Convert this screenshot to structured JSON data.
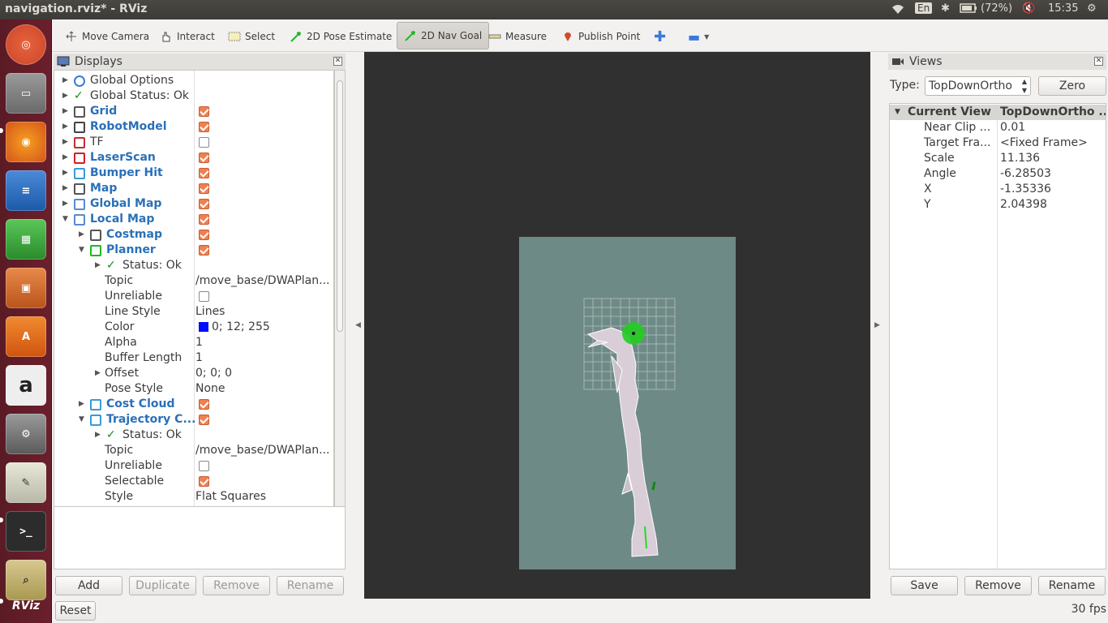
{
  "window": {
    "title": "navigation.rviz* - RViz"
  },
  "indicators": {
    "keyboard": "En",
    "battery": "(72%)",
    "time": "15:35"
  },
  "toolbar": {
    "tools": [
      {
        "label": "Move Camera",
        "icon": "move-camera-icon"
      },
      {
        "label": "Interact",
        "icon": "hand-icon"
      },
      {
        "label": "Select",
        "icon": "select-rect-icon"
      },
      {
        "label": "2D Pose Estimate",
        "icon": "green-arrow-icon"
      },
      {
        "label": "2D Nav Goal",
        "icon": "green-arrow-icon",
        "active": true
      },
      {
        "label": "Measure",
        "icon": "ruler-icon"
      },
      {
        "label": "Publish Point",
        "icon": "map-pin-icon"
      }
    ]
  },
  "displays": {
    "title": "Displays",
    "rows": [
      {
        "label": "Global Options",
        "type": "plain",
        "value": ""
      },
      {
        "label": "Global Status: Ok",
        "type": "plain",
        "value": ""
      },
      {
        "label": "Grid",
        "type": "display",
        "checked": true
      },
      {
        "label": "RobotModel",
        "type": "display",
        "checked": true
      },
      {
        "label": "TF",
        "type": "tf",
        "checked": false
      },
      {
        "label": "LaserScan",
        "type": "display",
        "checked": true
      },
      {
        "label": "Bumper Hit",
        "type": "display",
        "checked": true
      },
      {
        "label": "Map",
        "type": "display",
        "checked": true
      },
      {
        "label": "Global Map",
        "type": "display",
        "checked": true
      },
      {
        "label": "Local Map",
        "type": "display",
        "checked": true
      },
      {
        "label": "Costmap",
        "type": "display",
        "checked": true
      },
      {
        "label": "Planner",
        "type": "display",
        "checked": true
      },
      {
        "label": "Status: Ok",
        "type": "status",
        "value": ""
      },
      {
        "label": "Topic",
        "type": "prop",
        "value": "/move_base/DWAPlan..."
      },
      {
        "label": "Unreliable",
        "type": "prop-cb",
        "checked": false
      },
      {
        "label": "Line Style",
        "type": "prop",
        "value": "Lines"
      },
      {
        "label": "Color",
        "type": "prop-color",
        "value": "0; 12; 255",
        "swatch": "#000cff"
      },
      {
        "label": "Alpha",
        "type": "prop",
        "value": "1"
      },
      {
        "label": "Buffer Length",
        "type": "prop",
        "value": "1"
      },
      {
        "label": "Offset",
        "type": "prop",
        "value": "0; 0; 0"
      },
      {
        "label": "Pose Style",
        "type": "prop",
        "value": "None"
      },
      {
        "label": "Cost Cloud",
        "type": "display",
        "checked": true
      },
      {
        "label": "Trajectory C...",
        "type": "display",
        "checked": true
      },
      {
        "label": "Status: Ok",
        "type": "status",
        "value": ""
      },
      {
        "label": "Topic",
        "type": "prop",
        "value": "/move_base/DWAPlan..."
      },
      {
        "label": "Unreliable",
        "type": "prop-cb",
        "checked": false
      },
      {
        "label": "Selectable",
        "type": "prop-cb",
        "checked": true
      },
      {
        "label": "Style",
        "type": "prop",
        "value": "Flat Squares"
      }
    ],
    "buttons": {
      "add": "Add",
      "duplicate": "Duplicate",
      "remove": "Remove",
      "rename": "Rename"
    }
  },
  "views": {
    "title": "Views",
    "type_label": "Type:",
    "type_value": "TopDownOrtho",
    "zero_label": "Zero",
    "header": {
      "name": "Current View",
      "value": "TopDownOrtho ..."
    },
    "props": [
      {
        "label": "Near Clip ...",
        "value": "0.01"
      },
      {
        "label": "Target Fra...",
        "value": "<Fixed Frame>"
      },
      {
        "label": "Scale",
        "value": "11.136"
      },
      {
        "label": "Angle",
        "value": "-6.28503"
      },
      {
        "label": "X",
        "value": "-1.35336"
      },
      {
        "label": "Y",
        "value": "2.04398"
      }
    ],
    "buttons": {
      "save": "Save",
      "remove": "Remove",
      "rename": "Rename"
    }
  },
  "status": {
    "reset": "Reset",
    "fps": "30 fps"
  },
  "launcher": {
    "rviz_label": "RViz"
  }
}
